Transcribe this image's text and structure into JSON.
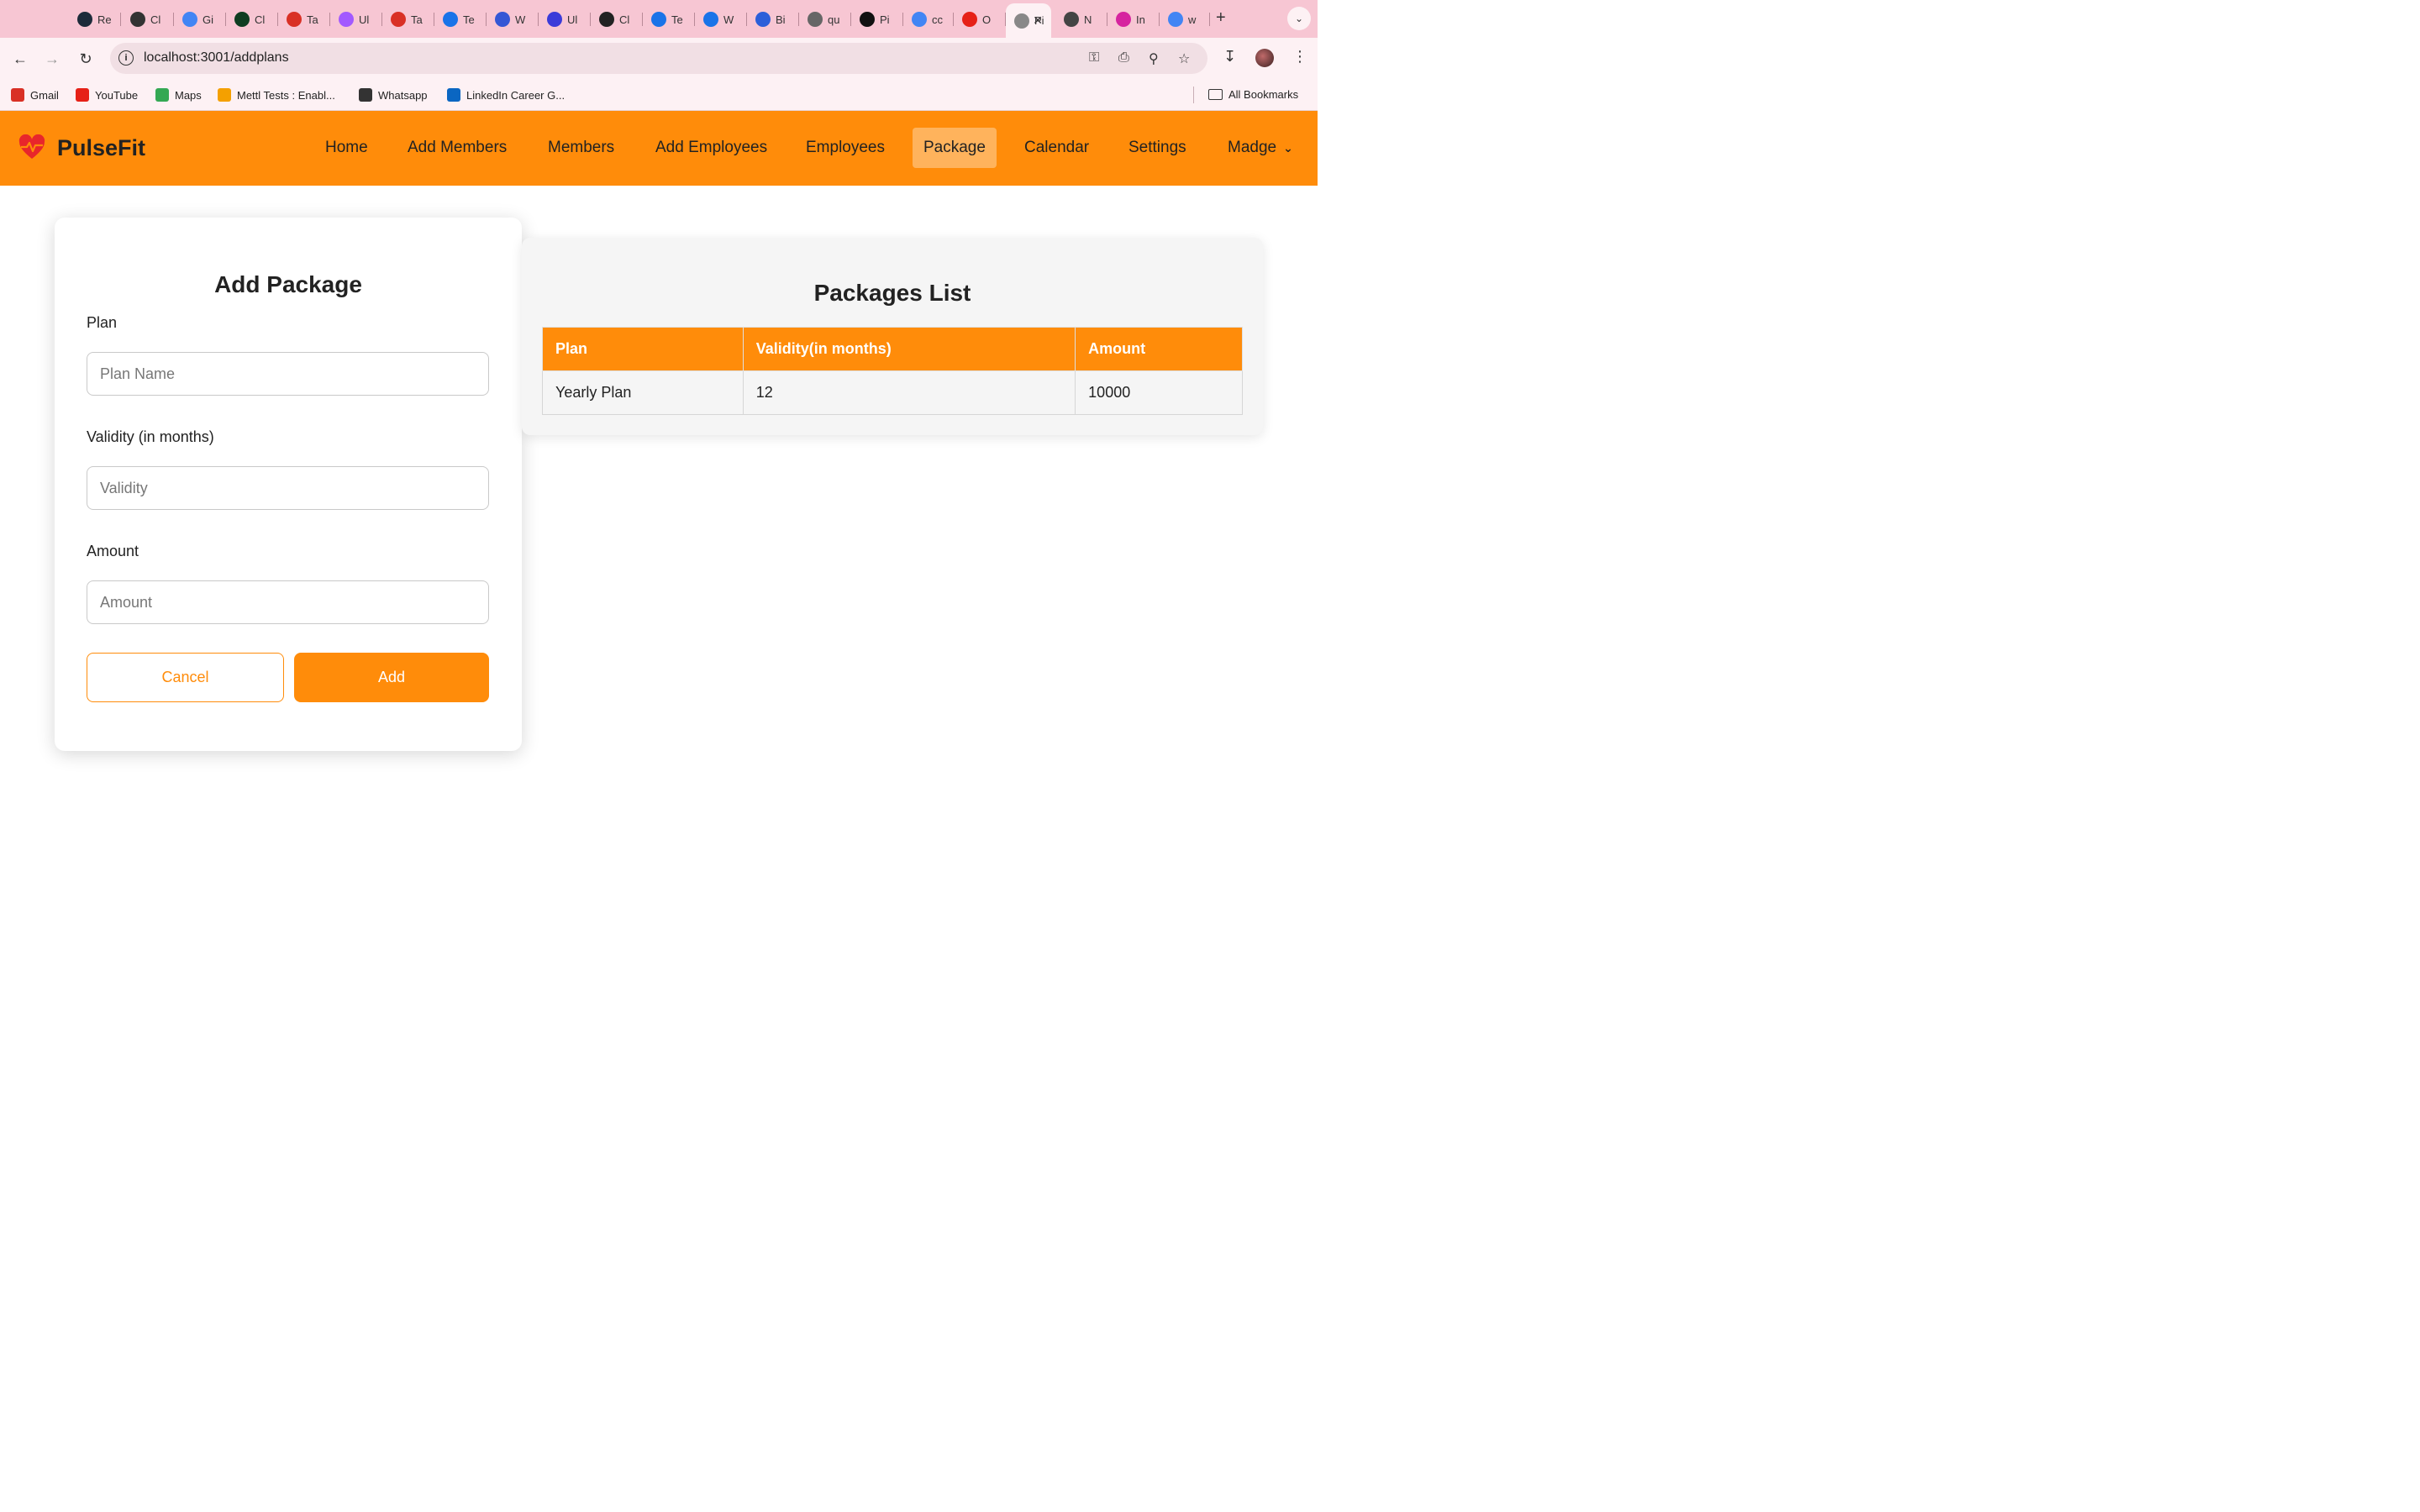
{
  "browser": {
    "tabs": [
      {
        "label": "Re",
        "icon": "react-icon",
        "color": "#1d2b3a"
      },
      {
        "label": "Cl",
        "icon": "openai-icon",
        "color": "#333333"
      },
      {
        "label": "Gi",
        "icon": "calendar-icon",
        "color": "#4285f4"
      },
      {
        "label": "Cl",
        "icon": "mongodb-icon",
        "color": "#0f3d21"
      },
      {
        "label": "Ta",
        "icon": "gmail-icon",
        "color": "#d93025"
      },
      {
        "label": "Ul",
        "icon": "figma-icon",
        "color": "#a259ff"
      },
      {
        "label": "Ta",
        "icon": "gmail-icon",
        "color": "#d93025"
      },
      {
        "label": "Te",
        "icon": "canva-icon",
        "color": "#1a73e8"
      },
      {
        "label": "W",
        "icon": "meet-icon",
        "color": "#3457d5"
      },
      {
        "label": "Ul",
        "icon": "app-icon",
        "color": "#3b3bd9"
      },
      {
        "label": "Cl",
        "icon": "openai-icon",
        "color": "#222222"
      },
      {
        "label": "Te",
        "icon": "canva-icon",
        "color": "#1a73e8"
      },
      {
        "label": "W",
        "icon": "canva-icon",
        "color": "#1a73e8"
      },
      {
        "label": "Bi",
        "icon": "app-icon",
        "color": "#2c5fd9"
      },
      {
        "label": "qu",
        "icon": "google-icon",
        "color": "#666666"
      },
      {
        "label": "Pi",
        "icon": "github-icon",
        "color": "#111111"
      },
      {
        "label": "cc",
        "icon": "google-icon",
        "color": "#4285f4"
      },
      {
        "label": "O",
        "icon": "youtube-icon",
        "color": "#e62117"
      },
      {
        "label": "Pi",
        "icon": "page-icon",
        "color": "#888888"
      },
      {
        "label": "N",
        "icon": "chrome-icon",
        "color": "#444444"
      },
      {
        "label": "In",
        "icon": "instagram-icon",
        "color": "#d6249f"
      },
      {
        "label": "w",
        "icon": "google-icon",
        "color": "#4285f4"
      }
    ],
    "active_tab_index": 18,
    "url": "localhost:3001/addplans",
    "bookmarks": [
      {
        "label": "Gmail",
        "icon": "gmail-icon",
        "color": "#d93025"
      },
      {
        "label": "YouTube",
        "icon": "youtube-icon",
        "color": "#e62117"
      },
      {
        "label": "Maps",
        "icon": "maps-icon",
        "color": "#34a853"
      },
      {
        "label": "Mettl Tests : Enabl...",
        "icon": "mettl-icon",
        "color": "#f4a000"
      },
      {
        "label": "Whatsapp",
        "icon": "globe-icon",
        "color": "#333333"
      },
      {
        "label": "LinkedIn Career G...",
        "icon": "linkedin-icon",
        "color": "#0a66c2"
      }
    ],
    "all_bookmarks": "All Bookmarks"
  },
  "app": {
    "brand": "PulseFit",
    "accent": "#ff8c0a",
    "nav": [
      "Home",
      "Add Members",
      "Members",
      "Add Employees",
      "Employees",
      "Package",
      "Calendar",
      "Settings"
    ],
    "active_nav": "Package",
    "user": "Madge"
  },
  "form": {
    "title": "Add Package",
    "plan_label": "Plan",
    "plan_placeholder": "Plan Name",
    "validity_label": "Validity (in months)",
    "validity_placeholder": "Validity",
    "amount_label": "Amount",
    "amount_placeholder": "Amount",
    "cancel": "Cancel",
    "add": "Add"
  },
  "packages": {
    "title": "Packages List",
    "headers": [
      "Plan",
      "Validity(in months)",
      "Amount"
    ],
    "rows": [
      [
        "Yearly Plan",
        "12",
        "10000"
      ]
    ]
  }
}
